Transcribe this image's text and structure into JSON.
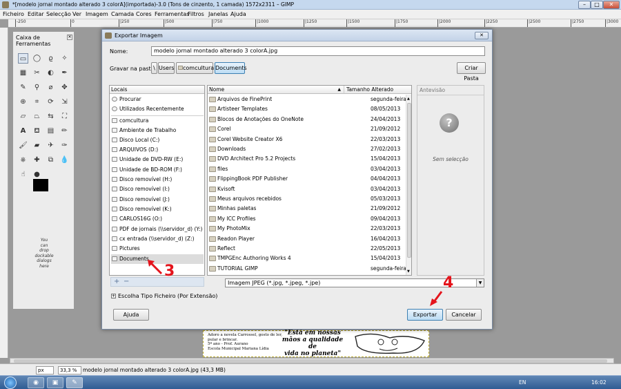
{
  "app": {
    "title": "*[modelo jornal montado alterado 3 colorA](importada)-3.0 (Tons de cinzento, 1 camada) 1572x2311 – GIMP",
    "menu": [
      "Ficheiro",
      "Editar",
      "Selecção",
      "Ver",
      "Imagem",
      "Camada",
      "Cores",
      "Ferramentas",
      "Filtros",
      "Janelas",
      "Ajuda"
    ],
    "ruler_ticks": [
      "-250",
      "0",
      "|250",
      "|500",
      "|750",
      "|1000",
      "|1250",
      "|1500",
      "|1750",
      "|2000",
      "|2250",
      "|2500",
      "|2750",
      "|3000"
    ]
  },
  "toolbox": {
    "title": "Caixa de Ferramentas",
    "dock_hint": [
      "You",
      "can",
      "drop",
      "dockable",
      "dialogs",
      "here"
    ]
  },
  "dialog": {
    "title": "Exportar Imagem",
    "name_label": "Nome:",
    "name_value": "modelo jornal montado alterado 3 colorA.jpg",
    "save_in_label": "Gravar na pasta:",
    "path": [
      "Users",
      "comcultura",
      "Documents"
    ],
    "create_folder": "Criar Pasta",
    "places_header": "Locais",
    "places": [
      "Procurar",
      "Utilizados Recentemente",
      "comcultura",
      "Ambiente de Trabalho",
      "Disco Local (C:)",
      "ARQUIVOS (D:)",
      "Unidade de DVD-RW (E:)",
      "Unidade de BD-ROM (F:)",
      "Disco removível (H:)",
      "Disco removível (I:)",
      "Disco removível (J:)",
      "Disco removível (K:)",
      "CARLOS16G (O:)",
      "PDF de jornais (\\\\servidor_d) (Y:)",
      "cx entrada (\\\\servidor_d) (Z:)",
      "Pictures",
      "Documents"
    ],
    "col_name": "Nome",
    "col_modified": "Tamanho Alterado",
    "files": [
      {
        "name": "Arquivos de FinePrint",
        "date": "segunda-feira"
      },
      {
        "name": "Artisteer Templates",
        "date": "08/05/2013"
      },
      {
        "name": "Blocos de Anotações do OneNote",
        "date": "24/04/2013"
      },
      {
        "name": "Corel",
        "date": "21/09/2012"
      },
      {
        "name": "Corel Website Creator X6",
        "date": "22/03/2013"
      },
      {
        "name": "Downloads",
        "date": "27/02/2013"
      },
      {
        "name": "DVD Architect Pro 5.2 Projects",
        "date": "15/04/2013"
      },
      {
        "name": "files",
        "date": "03/04/2013"
      },
      {
        "name": "FlippingBook PDF Publisher",
        "date": "04/04/2013"
      },
      {
        "name": "Kvisoft",
        "date": "03/04/2013"
      },
      {
        "name": "Meus arquivos recebidos",
        "date": "05/03/2013"
      },
      {
        "name": "Minhas paletas",
        "date": "21/09/2012"
      },
      {
        "name": "My ICC Profiles",
        "date": "09/04/2013"
      },
      {
        "name": "My PhotoMix",
        "date": "22/03/2013"
      },
      {
        "name": "Readon Player",
        "date": "16/04/2013"
      },
      {
        "name": "Reflect",
        "date": "22/05/2013"
      },
      {
        "name": "TMPGEnc Authoring Works 4",
        "date": "15/04/2013"
      },
      {
        "name": "TUTORIAL GIMP",
        "date": "segunda-feira"
      }
    ],
    "preview_title": "Antevisão",
    "preview_empty": "Sem selecção",
    "filter": "Imagem JPEG (*.jpg, *.jpeg, *.jpe)",
    "filetype_toggle": "Escolha Tipo Ficheiro (Por Extensão)",
    "help_btn": "Ajuda",
    "export_btn": "Exportar",
    "cancel_btn": "Cancelar"
  },
  "annotations": {
    "step3": "3",
    "step4": "4"
  },
  "canvas": {
    "left_text": [
      "Adoro a novela Carrossel, gosto de ler,",
      "pular e brincar.",
      "5º ano - Prof. Aurano",
      "Escola Municipal Mariana Lídia"
    ],
    "quote": [
      "\"Está em nossas",
      "mãos a qualidade de",
      "vida no planeta\""
    ]
  },
  "status": {
    "unit": "px",
    "zoom": "33,3 %",
    "file_info": "modelo jornal montado alterado 3 colorA.jpg (43,3 MB)"
  },
  "taskbar": {
    "lang": "EN",
    "time": "16:02"
  }
}
